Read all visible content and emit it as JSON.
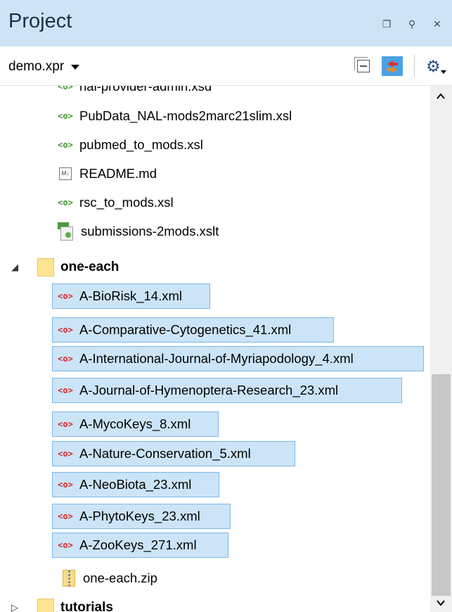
{
  "panel": {
    "title": "Project",
    "controls": [
      {
        "name": "restore-icon",
        "glyph": "❐"
      },
      {
        "name": "pin-icon",
        "glyph": "⚲"
      },
      {
        "name": "close-icon",
        "glyph": "✕"
      }
    ]
  },
  "toolbar": {
    "project_name": "demo.xpr",
    "collapse_all": "collapse-all-icon",
    "link_with_editor": "link-with-editor-icon",
    "settings": "gear-icon"
  },
  "tree": {
    "items": [
      {
        "label": "hal-provider-admin.xsd",
        "icon": "xsd-icon"
      },
      {
        "label": "PubData_NAL-mods2marc21slim.xsl",
        "icon": "xsl-icon"
      },
      {
        "label": "pubmed_to_mods.xsl",
        "icon": "xsl-icon"
      },
      {
        "label": "README.md",
        "icon": "markdown-icon"
      },
      {
        "label": "rsc_to_mods.xsl",
        "icon": "xsl-icon"
      },
      {
        "label": "submissions-2mods.xslt",
        "icon": "xslt-icon"
      },
      {
        "label": "one-each",
        "icon": "folder-icon",
        "expanded": true
      },
      {
        "label": "A-BioRisk_14.xml",
        "icon": "xml-icon",
        "selected": true
      },
      {
        "label": "A-Comparative-Cytogenetics_41.xml",
        "icon": "xml-icon",
        "selected": true
      },
      {
        "label": "A-International-Journal-of-Myriapodology_4.xml",
        "icon": "xml-icon",
        "selected": true
      },
      {
        "label": "A-Journal-of-Hymenoptera-Research_23.xml",
        "icon": "xml-icon",
        "selected": true
      },
      {
        "label": "A-MycoKeys_8.xml",
        "icon": "xml-icon",
        "selected": true
      },
      {
        "label": "A-Nature-Conservation_5.xml",
        "icon": "xml-icon",
        "selected": true
      },
      {
        "label": "A-NeoBiota_23.xml",
        "icon": "xml-icon",
        "selected": true
      },
      {
        "label": "A-PhytoKeys_23.xml",
        "icon": "xml-icon",
        "selected": true
      },
      {
        "label": "A-ZooKeys_271.xml",
        "icon": "xml-icon",
        "selected": true
      },
      {
        "label": "one-each.zip",
        "icon": "zip-icon"
      },
      {
        "label": "tutorials",
        "icon": "folder-icon",
        "expanded": false
      }
    ]
  },
  "colors": {
    "titlebar": "#cfe3f7",
    "selection": "#cce4f7",
    "selection_border": "#7db7e8",
    "accent": "#49a2e6"
  }
}
